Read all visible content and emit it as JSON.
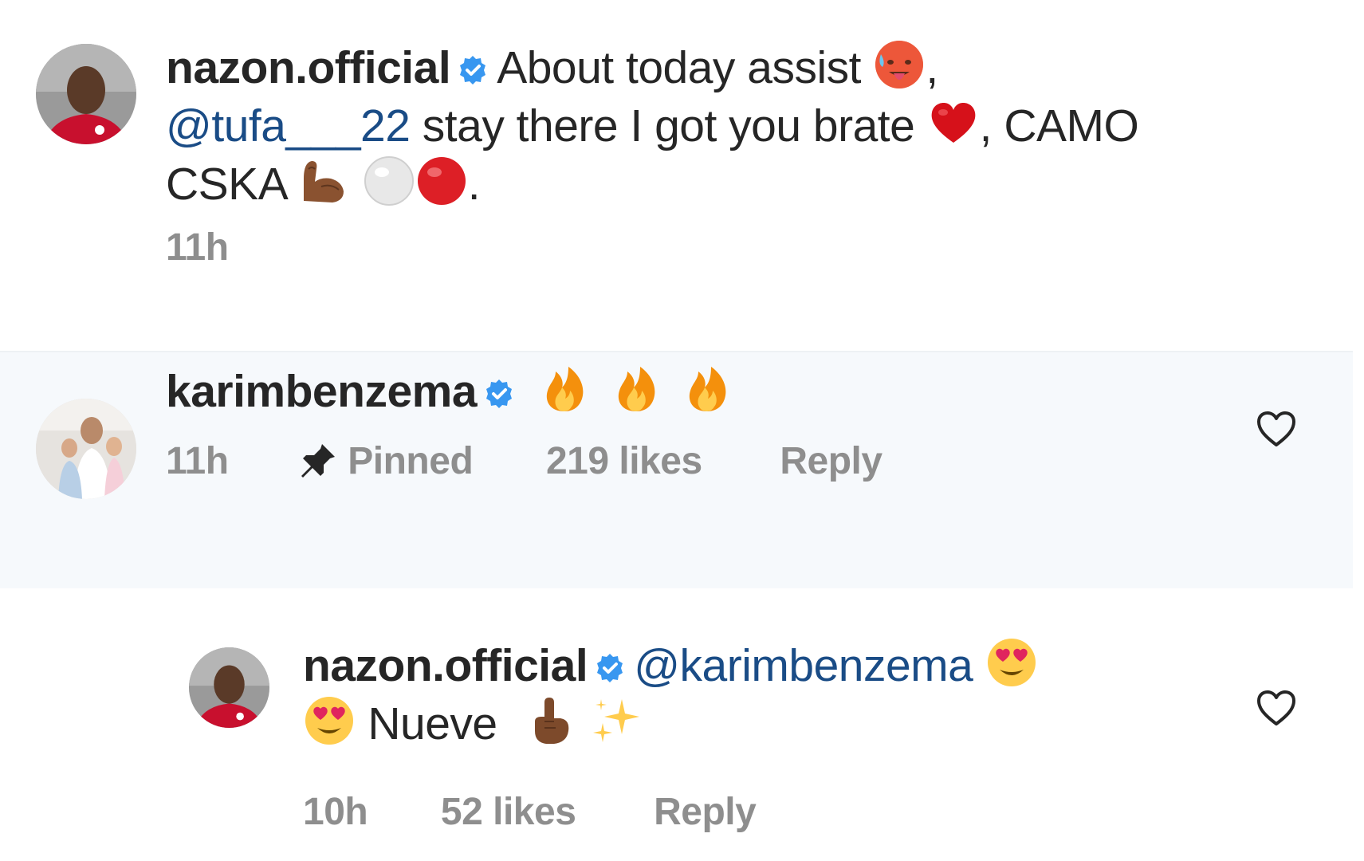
{
  "caption": {
    "username": "nazon.official",
    "text_1": "About today assist",
    "text_2": ",",
    "mention": "@tufa___22",
    "text_3": " stay there I got you brate ",
    "text_4": ", CAMO",
    "text_5": "CSKA ",
    "text_6": ".",
    "time": "11h"
  },
  "pinned_comment": {
    "username": "karimbenzema",
    "time": "11h",
    "pinned_label": "Pinned",
    "likes": "219 likes",
    "reply_label": "Reply"
  },
  "reply_comment": {
    "username": "nazon.official",
    "mention": "@karimbenzema",
    "text": " Nueve ",
    "time": "10h",
    "likes": "52 likes",
    "reply_label": "Reply"
  },
  "colors": {
    "text": "#262626",
    "mention": "#1a4c86",
    "meta": "#8e8e8e",
    "verified": "#3897f0",
    "pinned_bg": "#f6f9fc"
  },
  "icons": [
    "verified-badge-icon",
    "hot-face-emoji",
    "red-heart-emoji",
    "flexed-biceps-emoji",
    "white-circle-emoji",
    "red-circle-emoji",
    "fire-emoji",
    "pin-icon",
    "heart-outline-icon",
    "heart-eyes-emoji",
    "index-pointing-up-emoji",
    "sparkles-emoji"
  ]
}
